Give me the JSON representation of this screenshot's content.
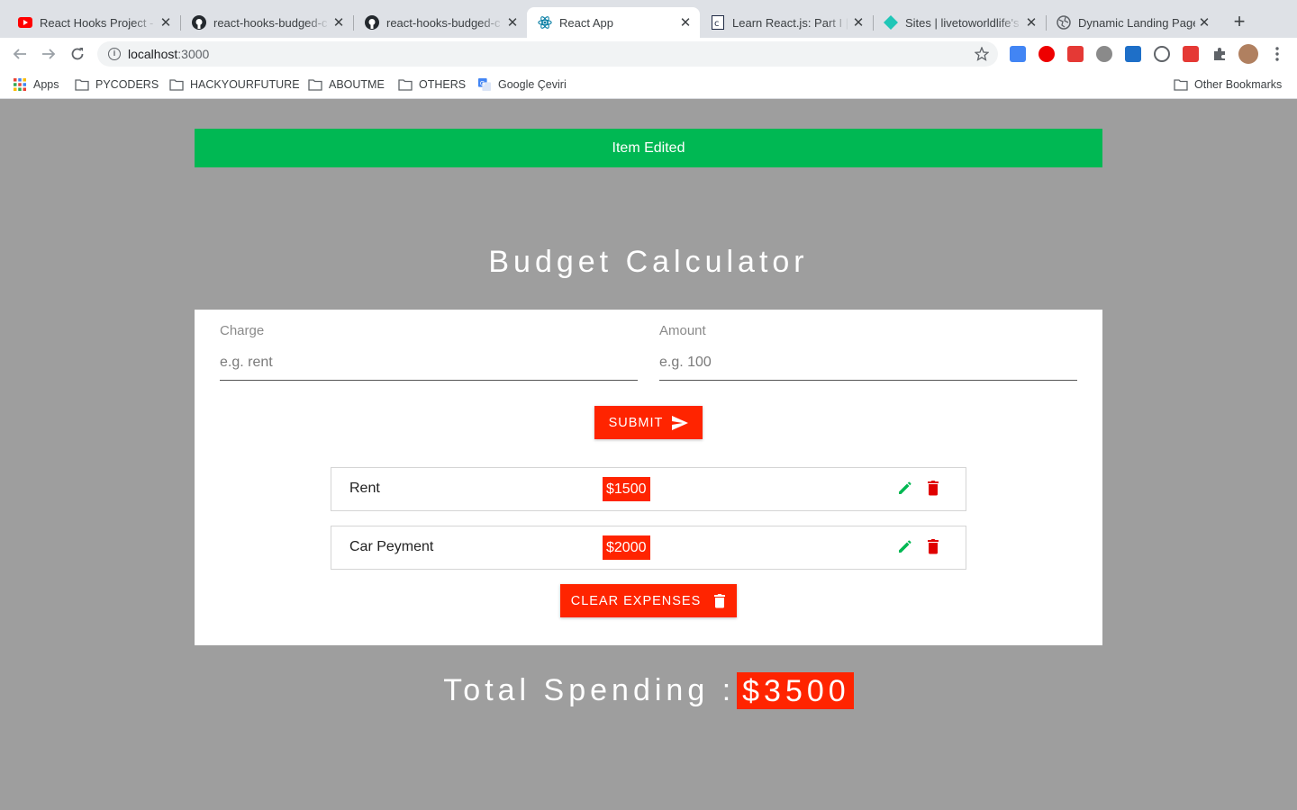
{
  "browser": {
    "tabs": [
      {
        "title": "React Hooks Project - ",
        "favicon": "youtube-icon"
      },
      {
        "title": "react-hooks-budged-c",
        "favicon": "github-icon"
      },
      {
        "title": "react-hooks-budged-c",
        "favicon": "github-icon"
      },
      {
        "title": "React App",
        "favicon": "react-icon",
        "active": true
      },
      {
        "title": "Learn React.js: Part I | ",
        "favicon": "codecademy-icon"
      },
      {
        "title": "Sites | livetoworldlife's",
        "favicon": "netlify-icon"
      },
      {
        "title": "Dynamic Landing Page",
        "favicon": "globe-icon"
      }
    ],
    "address": {
      "host": "localhost",
      "port": ":3000"
    },
    "bookmarks": {
      "apps": "Apps",
      "items": [
        "PYCODERS",
        "HACKYOURFUTURE",
        "ABOUTME",
        "OTHERS"
      ],
      "google_translate": "Google Çeviri",
      "other": "Other Bookmarks"
    }
  },
  "app": {
    "alert": {
      "text": "Item Edited",
      "color": "#00b853"
    },
    "title": "Budget Calculator",
    "form": {
      "charge_label": "Charge",
      "charge_placeholder": "e.g. rent",
      "charge_value": "",
      "amount_label": "Amount",
      "amount_placeholder": "e.g. 100",
      "amount_value": "",
      "submit_label": "SUBMIT"
    },
    "expenses": [
      {
        "charge": "Rent",
        "amount": "$1500"
      },
      {
        "charge": "Car Peyment",
        "amount": "$2000"
      }
    ],
    "clear_label": "CLEAR EXPENSES",
    "total_label": "Total Spending :",
    "total_value": "$3500",
    "accent_color": "#ff2400",
    "edit_color": "#00b853",
    "delete_color": "#e00000"
  }
}
